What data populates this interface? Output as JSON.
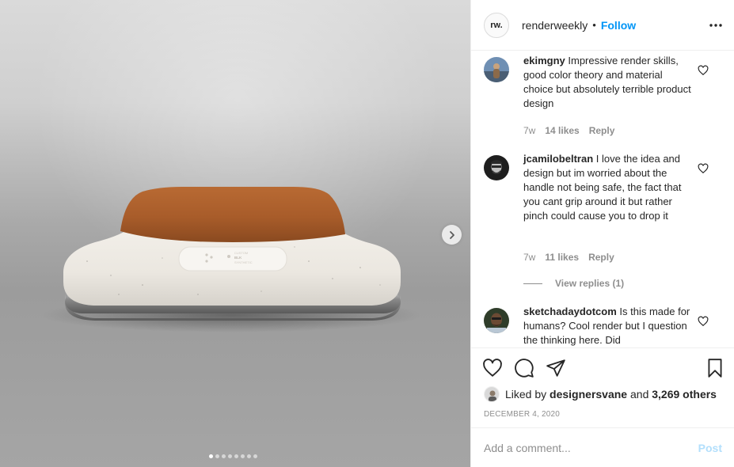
{
  "header": {
    "avatar_text": "rw.",
    "username": "renderweekly",
    "separator": "•",
    "follow_label": "Follow",
    "more_icon": "more-horizontal-icon"
  },
  "media": {
    "product_label_lines": [
      "CUSTOM",
      "BLK",
      "SYNTHETIC"
    ],
    "next_icon": "chevron-right-icon",
    "carousel_dot_count": 8,
    "carousel_active_index": 0
  },
  "comments": [
    {
      "username": "ekimgny",
      "text": "Impressive render skills, good color theory and material choice but absolutely terrible product design",
      "time": "7w",
      "likes": "14 likes",
      "reply_label": "Reply"
    },
    {
      "username": "jcamilobeltran",
      "text": "I love the idea and design but im worried about the handle not being safe, the fact that you cant grip around it but rather pinch could cause you to drop it",
      "time": "7w",
      "likes": "11 likes",
      "reply_label": "Reply",
      "view_replies": "View replies (1)"
    },
    {
      "username": "sketchadaydotcom",
      "text": "Is this made for humans? Cool render but I question the thinking here. Did"
    }
  ],
  "actions": {
    "like_icon": "heart-icon",
    "comment_icon": "comment-icon",
    "share_icon": "share-icon",
    "save_icon": "bookmark-icon",
    "liked_by_prefix": "Liked by",
    "liked_by_user": "designersvane",
    "liked_by_and": "and",
    "liked_by_others": "3,269 others",
    "date": "DECEMBER 4, 2020"
  },
  "add_comment": {
    "placeholder": "Add a comment...",
    "post_label": "Post"
  },
  "colors": {
    "follow_blue": "#0095f6",
    "post_disabled": "#b2dffc",
    "secondary_text": "#8e8e8e",
    "primary_text": "#262626",
    "divider": "#efefef"
  }
}
